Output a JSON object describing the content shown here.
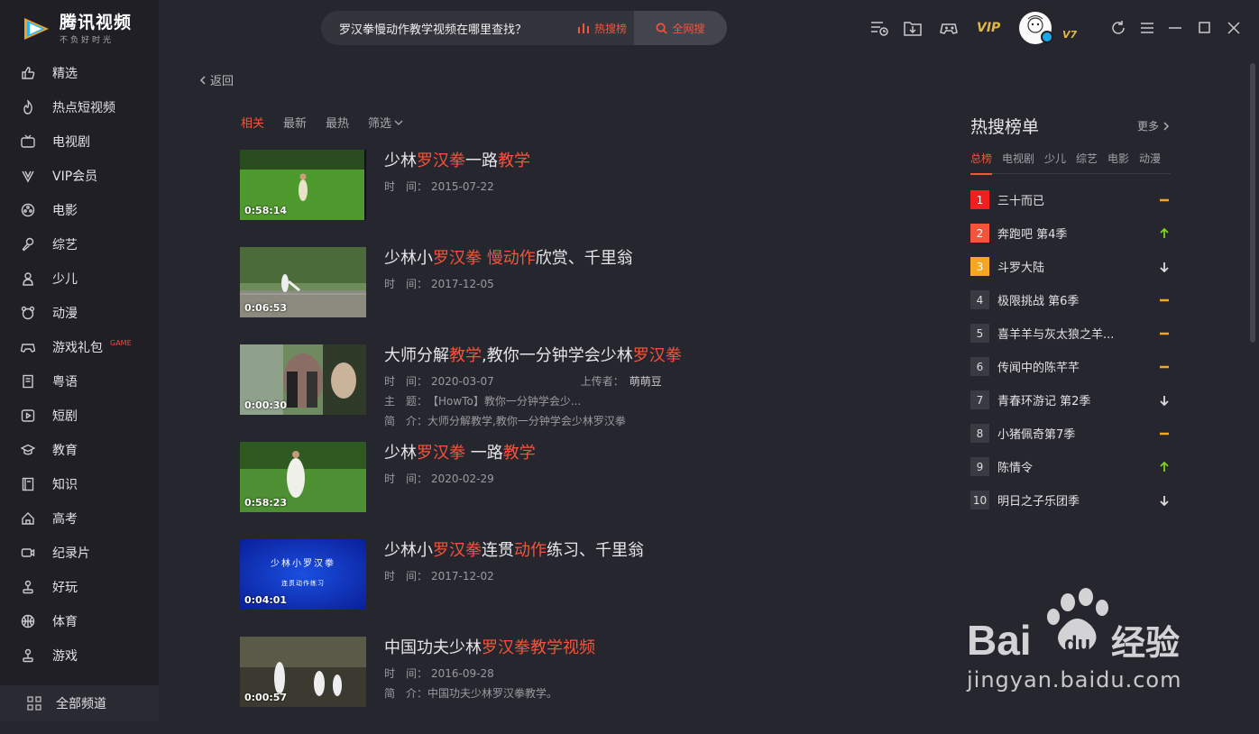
{
  "app": {
    "name": "腾讯视频",
    "slogan": "不负好时光"
  },
  "sidebar": {
    "items": [
      {
        "label": "精选",
        "icon": "thumbs-up-icon"
      },
      {
        "label": "热点短视频",
        "icon": "flame-icon"
      },
      {
        "label": "电视剧",
        "icon": "tv-icon"
      },
      {
        "label": "VIP会员",
        "icon": "vip-icon"
      },
      {
        "label": "电影",
        "icon": "film-reel-icon"
      },
      {
        "label": "综艺",
        "icon": "microphone-icon"
      },
      {
        "label": "少儿",
        "icon": "kid-icon"
      },
      {
        "label": "动漫",
        "icon": "bear-icon"
      },
      {
        "label": "游戏礼包",
        "icon": "gamepad-icon",
        "tag": "GAME"
      },
      {
        "label": "粤语",
        "icon": "book-icon"
      },
      {
        "label": "短剧",
        "icon": "play-square-icon"
      },
      {
        "label": "教育",
        "icon": "graduation-cap-icon"
      },
      {
        "label": "知识",
        "icon": "notebook-icon"
      },
      {
        "label": "高考",
        "icon": "pencil-house-icon"
      },
      {
        "label": "纪录片",
        "icon": "camera-icon"
      },
      {
        "label": "好玩",
        "icon": "joystick-icon"
      },
      {
        "label": "体育",
        "icon": "basketball-icon"
      },
      {
        "label": "游戏",
        "icon": "joystick2-icon"
      }
    ],
    "all_channels": "全部频道"
  },
  "search": {
    "value": "罗汉拳慢动作教学视频在哪里查找？",
    "hot_label": "热搜榜",
    "all_label": "全网搜"
  },
  "header": {
    "vip": "VIP",
    "vlevel": "V7"
  },
  "back_label": "返回",
  "filters": [
    {
      "label": "相关",
      "active": true
    },
    {
      "label": "最新"
    },
    {
      "label": "最热"
    },
    {
      "label": "筛选"
    }
  ],
  "results": [
    {
      "title_parts": [
        [
          "少林",
          0
        ],
        [
          "罗汉拳",
          1
        ],
        [
          "一路",
          0
        ],
        [
          "教学",
          1
        ]
      ],
      "time_label": "时　间：",
      "time": "2015-07-22",
      "duration": "0:58:14",
      "thumb": "grass"
    },
    {
      "title_parts": [
        [
          "少林小",
          0
        ],
        [
          "罗汉拳",
          1
        ],
        [
          " ",
          0
        ],
        [
          "慢动作",
          1
        ],
        [
          "欣赏、千里翁",
          0
        ]
      ],
      "time_label": "时　间：",
      "time": "2017-12-05",
      "duration": "0:06:53",
      "thumb": "park"
    },
    {
      "title_parts": [
        [
          "大师分解",
          0
        ],
        [
          "教学",
          1
        ],
        [
          ",教你一分钟学会少林",
          0
        ],
        [
          "罗汉拳",
          1
        ]
      ],
      "time_label": "时　间：",
      "time": "2020-03-07",
      "uploader_label": "上传者：",
      "uploader": "萌萌豆",
      "topic_label": "主　题：",
      "topic": "【HowTo】教你一分钟学会少...",
      "intro_label": "简　介：",
      "intro": "大师分解教学,教你一分钟学会少林罗汉拳",
      "duration": "0:00:30",
      "thumb": "blur"
    },
    {
      "title_parts": [
        [
          "少林",
          0
        ],
        [
          "罗汉拳",
          1
        ],
        [
          " 一路",
          0
        ],
        [
          "教学",
          1
        ]
      ],
      "time_label": "时　间：",
      "time": "2020-02-29",
      "duration": "0:58:23",
      "thumb": "grass2"
    },
    {
      "title_parts": [
        [
          "少林小",
          0
        ],
        [
          "罗汉拳",
          1
        ],
        [
          "连贯",
          0
        ],
        [
          "动作",
          1
        ],
        [
          "练习、千里翁",
          0
        ]
      ],
      "time_label": "时　间：",
      "time": "2017-12-02",
      "duration": "0:04:01",
      "thumb": "blue",
      "thumb_text1": "少林小罗汉拳",
      "thumb_text2": "连贯动作练习"
    },
    {
      "title_parts": [
        [
          "中国功夫少林",
          0
        ],
        [
          "罗汉拳教学视频",
          1
        ]
      ],
      "time_label": "时　间：",
      "time": "2016-09-28",
      "intro_label": "简　介：",
      "intro": "中国功夫少林罗汉拳教学。",
      "duration": "0:00:57",
      "thumb": "stage"
    }
  ],
  "hot": {
    "title": "热搜榜单",
    "more": "更多",
    "tabs": [
      {
        "label": "总榜",
        "active": true
      },
      {
        "label": "电视剧"
      },
      {
        "label": "少儿"
      },
      {
        "label": "综艺"
      },
      {
        "label": "电影"
      },
      {
        "label": "动漫"
      }
    ],
    "list": [
      {
        "rank": "1",
        "name": "三十而已",
        "trend": "flat"
      },
      {
        "rank": "2",
        "name": "奔跑吧 第4季",
        "trend": "up"
      },
      {
        "rank": "3",
        "name": "斗罗大陆",
        "trend": "down"
      },
      {
        "rank": "4",
        "name": "极限挑战 第6季",
        "trend": "flat"
      },
      {
        "rank": "5",
        "name": "喜羊羊与灰太狼之羊...",
        "trend": "flat"
      },
      {
        "rank": "6",
        "name": "传闻中的陈芊芊",
        "trend": "flat"
      },
      {
        "rank": "7",
        "name": "青春环游记 第2季",
        "trend": "down"
      },
      {
        "rank": "8",
        "name": "小猪佩奇第7季",
        "trend": "flat"
      },
      {
        "rank": "9",
        "name": "陈情令",
        "trend": "up"
      },
      {
        "rank": "10",
        "name": "明日之子乐团季",
        "trend": "down"
      }
    ]
  },
  "watermark": {
    "brand": "Bai du 经验",
    "url": "jingyan.baidu.com"
  },
  "colors": {
    "accent": "#f4553a",
    "bg": "#26262e",
    "sidebar": "#1f1f25"
  }
}
